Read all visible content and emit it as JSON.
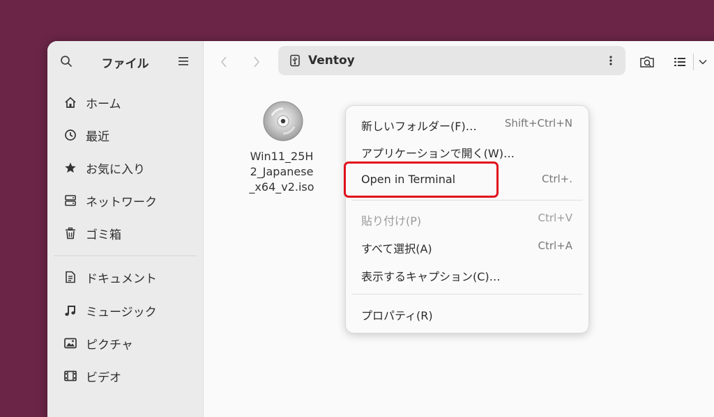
{
  "sidebar": {
    "title": "ファイル",
    "items": [
      {
        "label": "ホーム",
        "icon": "home-icon"
      },
      {
        "label": "最近",
        "icon": "recent-icon"
      },
      {
        "label": "お気に入り",
        "icon": "star-icon"
      },
      {
        "label": "ネットワーク",
        "icon": "network-icon"
      },
      {
        "label": "ゴミ箱",
        "icon": "trash-icon"
      },
      {
        "label": "ドキュメント",
        "icon": "document-icon"
      },
      {
        "label": "ミュージック",
        "icon": "music-icon"
      },
      {
        "label": "ピクチャ",
        "icon": "picture-icon"
      },
      {
        "label": "ビデオ",
        "icon": "video-icon"
      }
    ]
  },
  "pathbar": {
    "location": "Ventoy",
    "icon": "usb-drive-icon"
  },
  "files": [
    {
      "name": "Win11_25H\n2_Japanese\n_x64_v2.iso",
      "icon": "optical-disc-icon"
    }
  ],
  "context_menu": {
    "items": [
      {
        "label": "新しいフォルダー(F)…",
        "accel": "Shift+Ctrl+N"
      },
      {
        "label": "アプリケーションで開く(W)…",
        "accel": ""
      },
      {
        "label": "Open in Terminal",
        "accel": "Ctrl+."
      },
      {
        "label": "貼り付け(P)",
        "accel": "Ctrl+V",
        "disabled": true
      },
      {
        "label": "すべて選択(A)",
        "accel": "Ctrl+A"
      },
      {
        "label": "表示するキャプション(C)…",
        "accel": ""
      },
      {
        "label": "プロパティ(R)",
        "accel": ""
      }
    ]
  },
  "colors": {
    "desktop": "#6b2547",
    "highlight": "#e0101a",
    "sidebar": "#ebebeb"
  }
}
